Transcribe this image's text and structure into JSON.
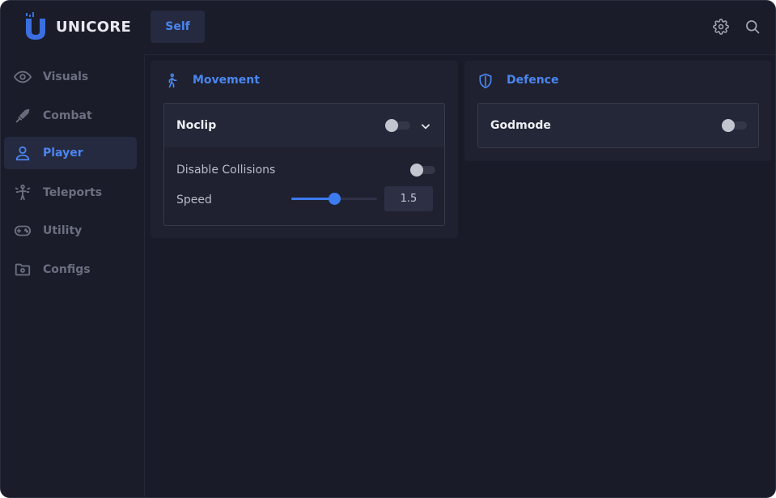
{
  "app": {
    "name": "UNICORE"
  },
  "header": {
    "tab_label": "Self",
    "icons": [
      "gear-icon",
      "search-icon"
    ]
  },
  "sidebar": {
    "items": [
      {
        "label": "Visuals",
        "icon": "eye-icon",
        "active": false
      },
      {
        "label": "Combat",
        "icon": "sword-icon",
        "active": false
      },
      {
        "label": "Player",
        "icon": "user-icon",
        "active": true
      },
      {
        "label": "Teleports",
        "icon": "teleport-icon",
        "active": false
      },
      {
        "label": "Utility",
        "icon": "gamepad-icon",
        "active": false
      },
      {
        "label": "Configs",
        "icon": "folder-icon",
        "active": false
      }
    ]
  },
  "movement": {
    "title": "Movement",
    "icon": "walking-icon",
    "noclip": {
      "label": "Noclip",
      "enabled": false,
      "expanded": true
    },
    "disable_collisions": {
      "label": "Disable Collisions",
      "enabled": false
    },
    "speed": {
      "label": "Speed",
      "value": "1.5",
      "fraction": 0.5
    }
  },
  "defence": {
    "title": "Defence",
    "icon": "shield-icon",
    "godmode": {
      "label": "Godmode",
      "enabled": false
    }
  },
  "colors": {
    "accent": "#4a86f0",
    "background": "#191b28",
    "panel": "#1f2130",
    "card": "#242737"
  }
}
